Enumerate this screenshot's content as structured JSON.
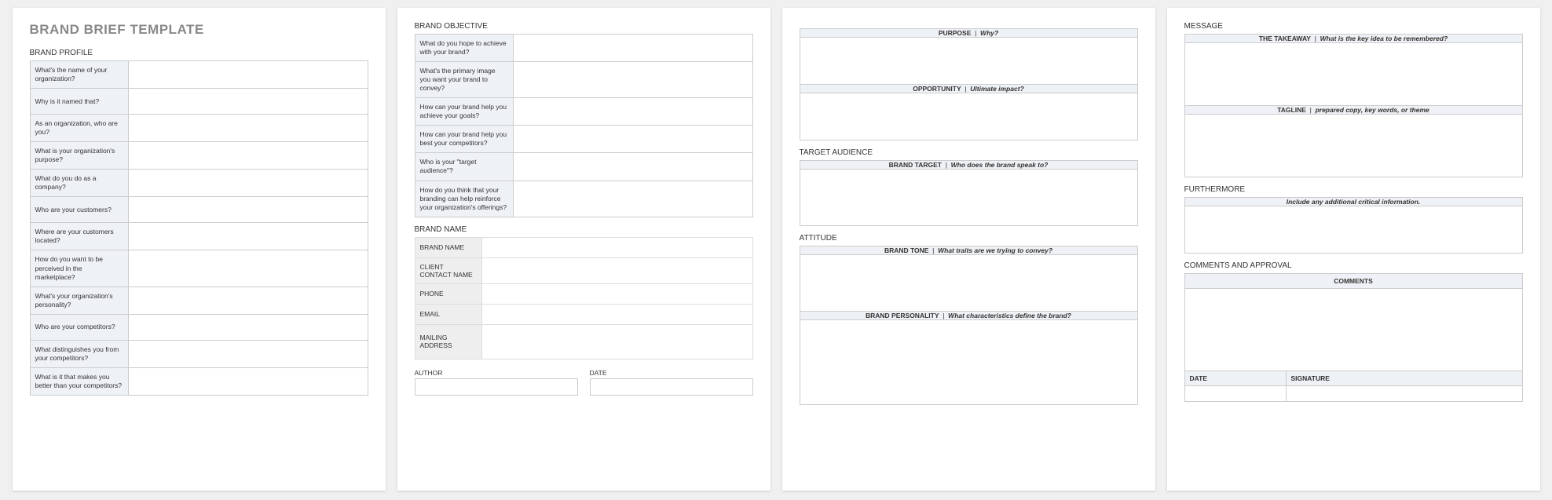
{
  "title": "BRAND BRIEF TEMPLATE",
  "sections": {
    "profile": {
      "header": "BRAND PROFILE",
      "rows": [
        "What's the name of your organization?",
        "Why is it named that?",
        "As an organization, who are you?",
        "What is your organization's purpose?",
        "What do you do as a company?",
        "Who are your customers?",
        "Where are your customers located?",
        "How do you want to be perceived in the marketplace?",
        "What's your organization's personality?",
        "Who are your competitors?",
        "What distinguishes you from your competitors?",
        "What is it that makes you better than your competitors?"
      ]
    },
    "objective": {
      "header": "BRAND OBJECTIVE",
      "rows": [
        "What do you hope to achieve with your brand?",
        "What's the primary image you want your brand to convey?",
        "How can your brand help you achieve your goals?",
        "How can your brand help you best your competitors?",
        "Who is your \"target audience\"?",
        "How do you think that your branding can help reinforce your organization's offerings?"
      ]
    },
    "brandname": {
      "header": "BRAND NAME",
      "rows": [
        "BRAND NAME",
        "CLIENT CONTACT NAME",
        "PHONE",
        "EMAIL",
        "MAILING ADDRESS"
      ]
    },
    "author": "AUTHOR",
    "date": "DATE",
    "purpose_h": "PURPOSE",
    "purpose_i": "Why?",
    "opportunity_h": "OPPORTUNITY",
    "opportunity_i": "Ultimate impact?",
    "target_header": "TARGET AUDIENCE",
    "target_h": "BRAND TARGET",
    "target_i": "Who does the brand speak to?",
    "attitude_header": "ATTITUDE",
    "tone_h": "BRAND TONE",
    "tone_i": "What traits are we trying to convey?",
    "personality_h": "BRAND PERSONALITY",
    "personality_i": "What characteristics define the brand?",
    "message_header": "MESSAGE",
    "takeaway_h": "THE TAKEAWAY",
    "takeaway_i": "What is the key idea to be remembered?",
    "tagline_h": "TAGLINE",
    "tagline_i": "prepared copy, key words, or theme",
    "furthermore_header": "FURTHERMORE",
    "furthermore_i": "Include any additional critical information.",
    "comments_header": "COMMENTS AND APPROVAL",
    "comments_h": "COMMENTS",
    "date_h": "DATE",
    "signature_h": "SIGNATURE"
  }
}
